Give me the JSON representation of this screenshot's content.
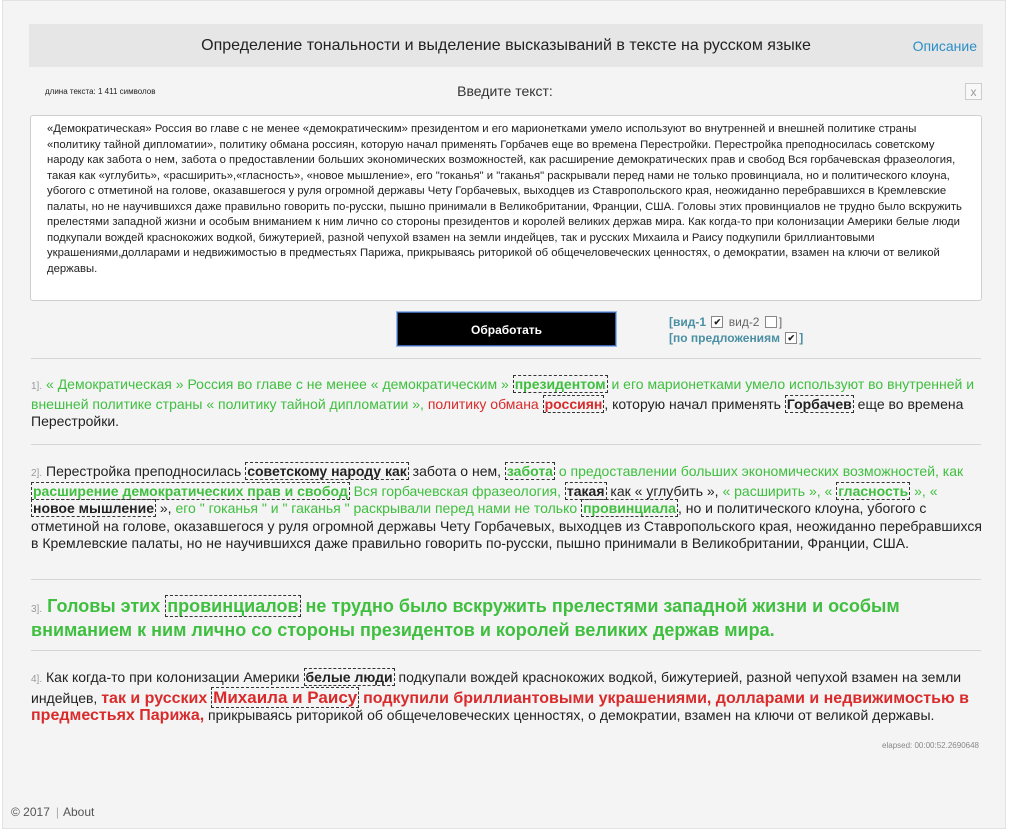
{
  "header": {
    "title": "Определение тональности и выделение высказываний в тексте на русском языке",
    "link": "Описание"
  },
  "input_area": {
    "length_label": "длина текста: 1 411 символов",
    "prompt": "Введите текст:",
    "clear_label": "x",
    "value": "«Демократическая» Россия во главе с не менее «демократическим» президентом и его марионетками умело используют во внутренней и внешней политике страны «политику тайной дипломатии», политику обмана россиян, которую начал применять Горбачев еще во времена Перестройки. Перестройка преподносилась советскому народу как забота о нем, забота о предоставлении больших экономических возможностей, как расширение демократических прав и свобод Вся горбачевская фразеология, такая как «углубить», «расширить»,«гласность», «новое мышление», его \"гоканья\" и \"гаканья\" раскрывали перед нами не только провинциала, но и политического клоуна, убогого с отметиной на голове, оказавшегося у руля огромной державы Чету Горбачевых, выходцев из Ставропольского края, неожиданно перебравшихся в Кремлевские палаты, но не научившихся даже правильно говорить по-русски, пышно принимали в Великобритании, Франции, США. Головы этих провинциалов не трудно было вскружить прелестями западной жизни и особым вниманием к ним лично со стороны президентов и королей великих держав мира. Как когда-то при колонизации Америки белые люди подкупали вождей краснокожих водкой, бижутерией, разной чепухой взамен на земли индейцев, так и русских Михаила и Раису подкупили бриллиантовыми украшениями,долларами и недвижимостью в предместьях Парижа, прикрываясь риторикой об общечеловеческих ценностях, о демократии, взамен на ключи от великой державы."
  },
  "process_button": "Обработать",
  "options": {
    "view1": "[вид-1",
    "view2": "вид-2",
    "view2_end": "]",
    "by_sentence": "[по предложениям",
    "by_sentence_end": "]",
    "view1_checked": true,
    "view2_checked": false,
    "by_sentence_checked": true,
    "check_glyph": "✔"
  },
  "results": [
    {
      "num": "1].",
      "s": [
        "« Демократическая » Россия во главе с не менее « демократическим »",
        "президентом",
        "и его марионетками умело используют во внутренней и внешней политике страны « политику тайной дипломатии »,",
        "политику обмана",
        "россиян",
        ", которую начал применять",
        "Горбачев",
        "еще во времена Перестройки."
      ]
    },
    {
      "num": "2].",
      "s": [
        "Перестройка преподносилась",
        "советскому народу как",
        "забота о нем,",
        "забота",
        "о предоставлении больших экономических возможностей, как",
        "расширение демократических прав и свобод",
        "Вся горбачевская фразеология,",
        "такая",
        "как « углубить »,",
        "« расширить », «",
        "гласность",
        "», «",
        "новое мышление",
        "»,",
        "его \" гоканья \" и \" гаканья \" раскрывали перед нами не только",
        "провинциала",
        ", но и политического клоуна, убогого с отметиной на голове, оказавшегося у руля огромной державы Чету Горбачевых, выходцев из Ставропольского края, неожиданно перебравшихся в Кремлевские палаты, но не научившихся даже правильно говорить по-русски, пышно принимали в Великобритании, Франции, США."
      ]
    },
    {
      "num": "3].",
      "s": [
        "Головы этих",
        "провинциалов",
        "не трудно было вскружить прелестями западной жизни и особым вниманием к ним лично со стороны президентов и королей великих держав мира."
      ]
    },
    {
      "num": "4].",
      "s": [
        "Как когда-то при колонизации Америки",
        "белые люди",
        "подкупали вождей краснокожих водкой, бижутерией, разной чепухой взамен на земли индейцев,",
        "так и русских",
        "Михаила и Раису",
        "подкупили бриллиантовыми украшениями, долларами и недвижимостью в предместьях Парижа,",
        "прикрываясь риторикой об общечеловеческих ценностях, о демократии, взамен на ключи от великой державы."
      ]
    }
  ],
  "elapsed": "elapsed: 00:00:52.2690648",
  "footer": {
    "copyright": "© 2017",
    "sep": "|",
    "about": "About"
  },
  "colors": {
    "positive": "#3fbf3f",
    "negative": "#d92b2b",
    "link": "#2b8fc6",
    "button_bg": "#000000"
  }
}
